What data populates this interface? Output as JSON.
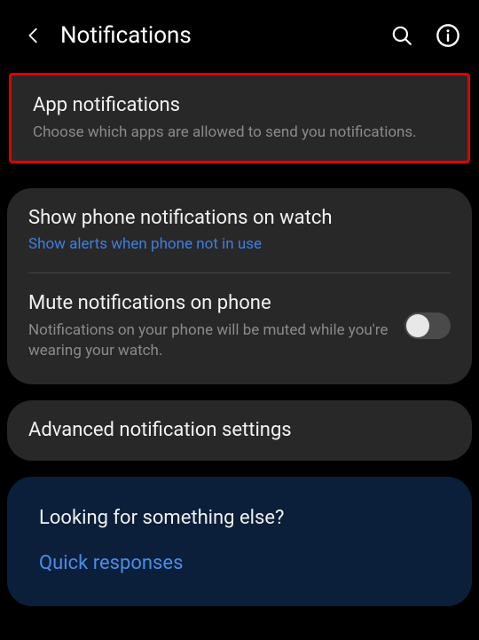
{
  "header": {
    "title": "Notifications"
  },
  "appNotifications": {
    "title": "App notifications",
    "subtitle": "Choose which apps are allowed to send you notifications."
  },
  "showOnWatch": {
    "title": "Show phone notifications on watch",
    "subtitle": "Show alerts when phone not in use"
  },
  "muteOnPhone": {
    "title": "Mute notifications on phone",
    "subtitle": "Notifications on your phone will be muted while you're wearing your watch.",
    "enabled": false
  },
  "advanced": {
    "title": "Advanced notification settings"
  },
  "footer": {
    "prompt": "Looking for something else?",
    "link": "Quick responses"
  }
}
